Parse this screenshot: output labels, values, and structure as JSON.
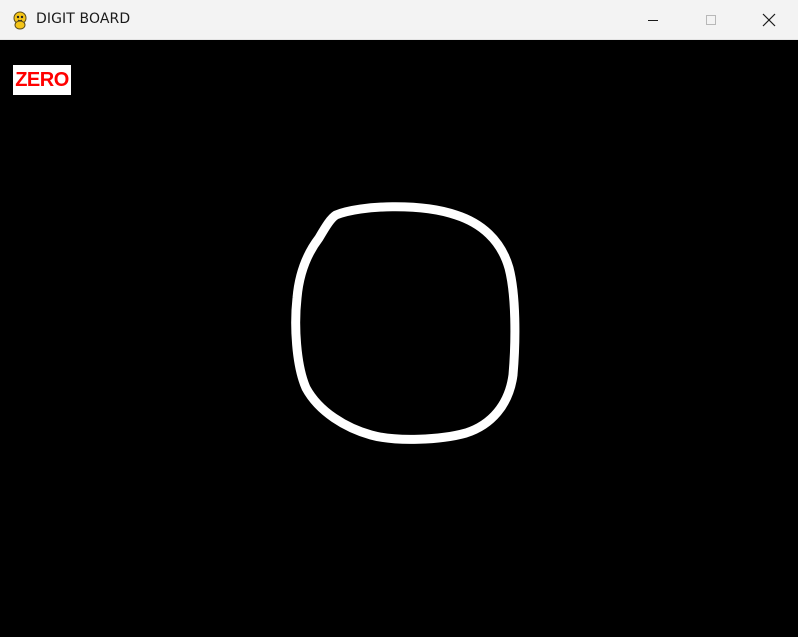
{
  "window": {
    "title": "DIGIT BOARD"
  },
  "canvas": {
    "background": "#000000",
    "stroke_color": "#ffffff",
    "prediction_label": "ZERO",
    "prediction_label_color": "#ff0000",
    "prediction_label_bg": "#ffffff"
  },
  "icons": {
    "app": "pygame-snake-icon",
    "minimize": "minimize-icon",
    "maximize": "maximize-icon",
    "close": "close-icon"
  }
}
